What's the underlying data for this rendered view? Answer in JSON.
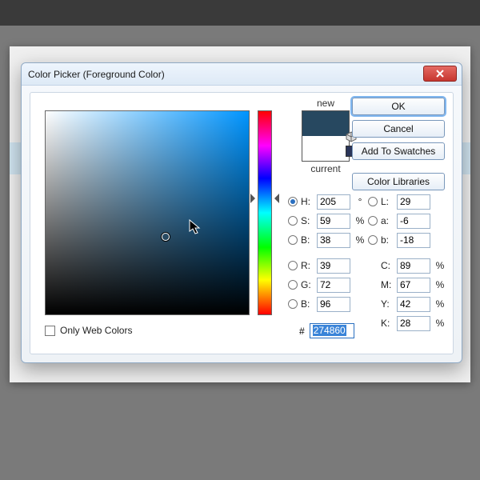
{
  "dialog": {
    "title": "Color Picker (Foreground Color)",
    "close": "X"
  },
  "swatch": {
    "new_label": "new",
    "current_label": "current",
    "new_color": "#274860",
    "current_color": "#ffffff",
    "mini_color": "#2a3559"
  },
  "buttons": {
    "ok": "OK",
    "cancel": "Cancel",
    "add_swatches": "Add To Swatches",
    "libraries": "Color Libraries"
  },
  "fields": {
    "H": {
      "label": "H:",
      "value": "205",
      "unit": "°",
      "radio": true,
      "selected": true
    },
    "S": {
      "label": "S:",
      "value": "59",
      "unit": "%",
      "radio": true
    },
    "B": {
      "label": "B:",
      "value": "38",
      "unit": "%",
      "radio": true
    },
    "R": {
      "label": "R:",
      "value": "39",
      "radio": true
    },
    "G": {
      "label": "G:",
      "value": "72",
      "radio": true
    },
    "Bb": {
      "label": "B:",
      "value": "96",
      "radio": true
    },
    "L": {
      "label": "L:",
      "value": "29",
      "radio": true
    },
    "a": {
      "label": "a:",
      "value": "-6",
      "radio": true
    },
    "bb": {
      "label": "b:",
      "value": "-18",
      "radio": true
    },
    "C": {
      "label": "C:",
      "value": "89",
      "unit": "%"
    },
    "M": {
      "label": "M:",
      "value": "67",
      "unit": "%"
    },
    "Y": {
      "label": "Y:",
      "value": "42",
      "unit": "%"
    },
    "K": {
      "label": "K:",
      "value": "28",
      "unit": "%"
    }
  },
  "hex": {
    "hash": "#",
    "value": "274860"
  },
  "web_only": {
    "label": "Only Web Colors",
    "checked": false
  },
  "sv_marker": {
    "x_pct": 59,
    "y_pct": 62
  },
  "hue_pos_pct": 43
}
